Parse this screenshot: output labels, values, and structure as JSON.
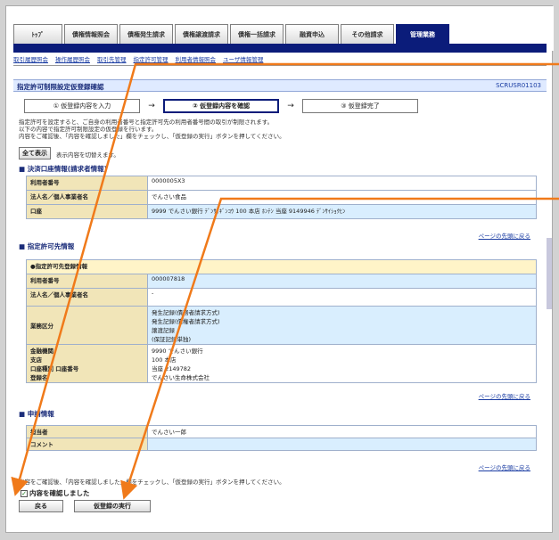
{
  "tabs": [
    "ﾄｯﾌﾟ",
    "債権情報照会",
    "債権発生請求",
    "債権譲渡請求",
    "債権一括請求",
    "融資申込",
    "その他請求",
    "管理業務"
  ],
  "subnav": [
    "取引履歴照会",
    "操作履歴照会",
    "取引先管理",
    "指定許可管理",
    "利用者情報照会",
    "ユーザ情報管理"
  ],
  "page": {
    "title": "指定許可制限設定仮登録確認",
    "code": "SCRUSR01103"
  },
  "steps": [
    "① 仮登録内容を入力",
    "② 仮登録内容を確認",
    "③ 仮登録完了"
  ],
  "step_arrow": "→",
  "intro": [
    "指定許可を設定すると、ご自身の利用者番号と指定許可先の利用者番号間の取引が制限されます。",
    "以下の内容で指定許可制限設定の仮登録を行います。",
    "内容をご確認後、「内容を確認しました」欄をチェックし、「仮登録の実行」ボタンを押してください。"
  ],
  "show_all_button": "全て表示",
  "show_all_hint": "表示内容を切替えます。",
  "sections": {
    "payer": {
      "title": "決済口座情報(請求者情報)",
      "rows": [
        {
          "label": "利用者番号",
          "value": "0000005X3"
        },
        {
          "label": "法人名／個人事業者名",
          "value": "でんさい食品"
        },
        {
          "label": "口座",
          "value": "9999 でんさい銀行 ﾃﾞﾝｻｲｷﾞﾝｺｳ 100 本店 ﾎﾝﾃﾝ 当座 9149946 ﾃﾞﾝｻｲｼｮｸﾋﾝ"
        }
      ]
    },
    "permit": {
      "title": "指定許可先情報",
      "subheader": "●指定許可先登録情報",
      "rows": [
        {
          "label": "利用者番号",
          "value": "000007818"
        },
        {
          "label": "法人名／個人事業者名",
          "value": "-"
        },
        {
          "label": "業務区分",
          "value": [
            "発生記録(債務者請求方式)",
            "発生記録(債権者請求方式)",
            "譲渡記録",
            "(保証記録単独)"
          ]
        },
        {
          "label": [
            "金融機関",
            "支店",
            "口座種別 口座番号",
            "登録名"
          ],
          "value": [
            "9990 でんさい銀行",
            "100 本店",
            "当座 2149782",
            "でんさい生命株式会社"
          ]
        }
      ]
    },
    "applicant": {
      "title": "申請情報",
      "rows": [
        {
          "label": "担当者",
          "value": "でんさい一郎"
        },
        {
          "label": "コメント",
          "value": ""
        }
      ]
    }
  },
  "back_to_top": "ページの先頭に戻る",
  "confirm_note": "内容をご確認後、「内容を確認しました」欄をチェックし、「仮登録の実行」ボタンを押してください。",
  "confirm_check_label": "内容を確認しました",
  "confirm_checked": true,
  "check_mark": "✓",
  "back_button": "戻る",
  "execute_button": "仮登録の実行",
  "colors": {
    "nav_dark": "#0b1c7a",
    "label_bg": "#f1e5b8",
    "alt_bg": "#d9eefe",
    "annotation_arrow": "#f07a1a"
  }
}
